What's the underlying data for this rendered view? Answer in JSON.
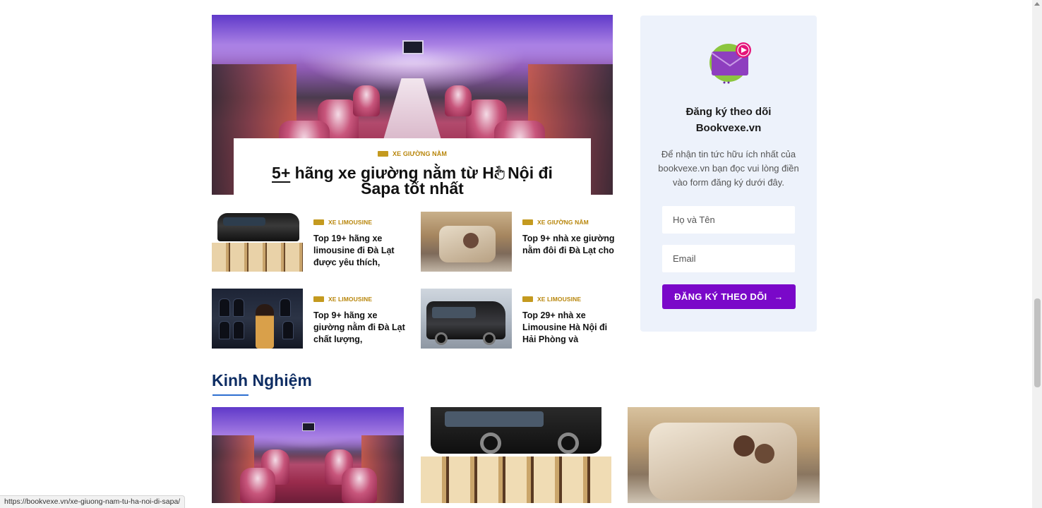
{
  "featured": {
    "category": "XE GIƯỜNG NẰM",
    "title_number": "5+",
    "title_rest": " hãng xe giường nằm từ Hà Nội đi Sapa tốt nhất"
  },
  "posts": [
    {
      "category": "XE LIMOUSINE",
      "title": "Top 19+ hãng xe limousine đi Đà Lạt được yêu thích,"
    },
    {
      "category": "XE GIƯỜNG NẰM",
      "title": "Top 9+ nhà xe giường nằm đôi đi Đà Lạt cho"
    },
    {
      "category": "XE LIMOUSINE",
      "title": "Top 9+ hãng xe giường nằm đi Đà Lạt chất lượng,"
    },
    {
      "category": "XE LIMOUSINE",
      "title": "Top 29+ nhà xe Limousine Hà Nội đi Hải Phòng và"
    }
  ],
  "subscribe": {
    "title_line1": "Đăng ký theo dõi",
    "title_line2": "Bookvexe.vn",
    "description": "Để nhận tin tức hữu ích nhất của bookvexe.vn bạn đọc vui lòng điền vào form đăng ký dưới đây.",
    "name_placeholder": "Họ và Tên",
    "email_placeholder": "Email",
    "button_label": "ĐĂNG KÝ THEO DÕI",
    "button_arrow": "→",
    "button_color": "#7a08c9"
  },
  "section": {
    "title": "Kinh Nghiệm"
  },
  "statusbar": {
    "url": "https://bookvexe.vn/xe-giuong-nam-tu-ha-noi-di-sapa/"
  },
  "colors": {
    "category": "#b8860b",
    "section_title": "#0e2d63",
    "section_underline": "#2d6fd1",
    "sidebar_bg": "#edf2fb"
  },
  "icons": {
    "subscribe": "mail-icon",
    "category": "flag-icon",
    "cursor": "hand-cursor-icon"
  }
}
